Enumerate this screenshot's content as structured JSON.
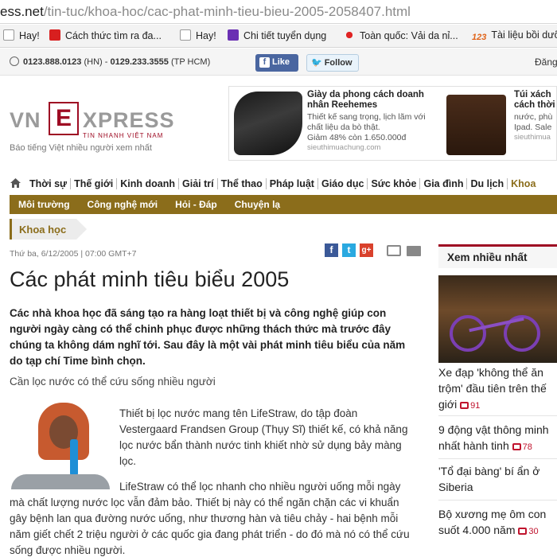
{
  "browser": {
    "url_host": "ess.net",
    "url_path": "/tin-tuc/khoa-hoc/cac-phat-minh-tieu-bieu-2005-2058407.html",
    "bookmarks": [
      {
        "label": "Hay!",
        "icon": "page-icon"
      },
      {
        "label": "Cách thức tìm ra đa...",
        "icon": "red-app-icon"
      },
      {
        "label": "Hay!",
        "icon": "page-icon"
      },
      {
        "label": "Chi tiết tuyển dụng",
        "icon": "purple-shield-icon"
      },
      {
        "label": "Toàn quốc: Vải da nỉ...",
        "icon": "red-star-icon"
      },
      {
        "label": "Tài liệu bồi dưỡ",
        "icon": "123-icon"
      }
    ]
  },
  "topbar": {
    "phone_hn": "0123.888.0123",
    "phone_hn_suffix": "(HN) -",
    "phone_hcm": "0129.233.3555",
    "phone_hcm_suffix": "(TP HCM)",
    "like_label": "Like",
    "follow_label": "Follow",
    "login_label": "Đăng"
  },
  "header": {
    "logo_left": "VN",
    "logo_mid": "E",
    "logo_right": "XPRESS",
    "logo_sub": "TIN NHANH VIỆT NAM",
    "tagline": "Báo tiếng Việt nhiều người xem nhất"
  },
  "ad": {
    "title1": "Giày da phong cách doanh nhân Reehemes",
    "desc1": "Thiết kế sang trọng, lịch lãm với chất liệu da bò thật.",
    "price1": "Giảm 48% còn 1.650.000đ",
    "site1": "sieuthimuachung.com",
    "title2": "Túi xách cách thời",
    "desc2": "nước, phù Ipad. Sale",
    "site2": "sieuthimua"
  },
  "nav": {
    "items": [
      "Thời sự",
      "Thế giới",
      "Kinh doanh",
      "Giải trí",
      "Thể thao",
      "Pháp luật",
      "Giáo dục",
      "Sức khỏe",
      "Gia đình",
      "Du lịch",
      "Khoa"
    ],
    "sub_items": [
      "Môi trường",
      "Công nghệ mới",
      "Hỏi - Đáp",
      "Chuyện lạ"
    ],
    "section": "Khoa học"
  },
  "article": {
    "date": "Thứ ba, 6/12/2005 | 07:00 GMT+7",
    "title": "Các phát minh tiêu biểu 2005",
    "lead": "Các nhà khoa học đã sáng tạo ra hàng loạt thiết bị và công nghệ giúp con người ngày càng có thể chinh phục được những thách thức mà trước đây chúng ta không dám nghĩ tới. Sau đây là một vài phát minh tiêu biểu của năm do tạp chí Time bình chọn.",
    "caption": "Cần lọc nước có thể cứu sống nhiều người",
    "body1": "Thiết bị lọc nước mang tên LifeStraw, do tập đoàn Vestergaard Frandsen Group (Thụy Sĩ) thiết kế, có khả năng lọc nước bẩn thành nước tinh khiết nhờ sử dụng bảy màng lọc.",
    "body2": "LifeStraw có thể lọc nhanh cho nhiều người uống mỗi ngày mà chất lượng nước lọc vẫn đảm bảo. Thiết bị này có thể ngăn chặn các vi khuẩn gây bệnh lan qua đường nước uống, như thương hàn và tiêu chảy - hai bệnh mỗi năm giết chết 2 triệu người ở các quốc gia đang phát triển - do đó mà nó có thể cứu sống được nhiều người."
  },
  "sidebar": {
    "heading": "Xem nhiều nhất",
    "items": [
      {
        "text": "Xe đạp 'không thể ăn trộm' đầu tiên trên thế giới",
        "count": "91"
      },
      {
        "text": "9 động vật thông minh nhất hành tinh",
        "count": "78"
      },
      {
        "text": "'Tổ đại bàng' bí ẩn ở Siberia",
        "count": ""
      },
      {
        "text": "Bộ xương mẹ ôm con suốt 4.000 năm",
        "count": "30"
      }
    ]
  }
}
